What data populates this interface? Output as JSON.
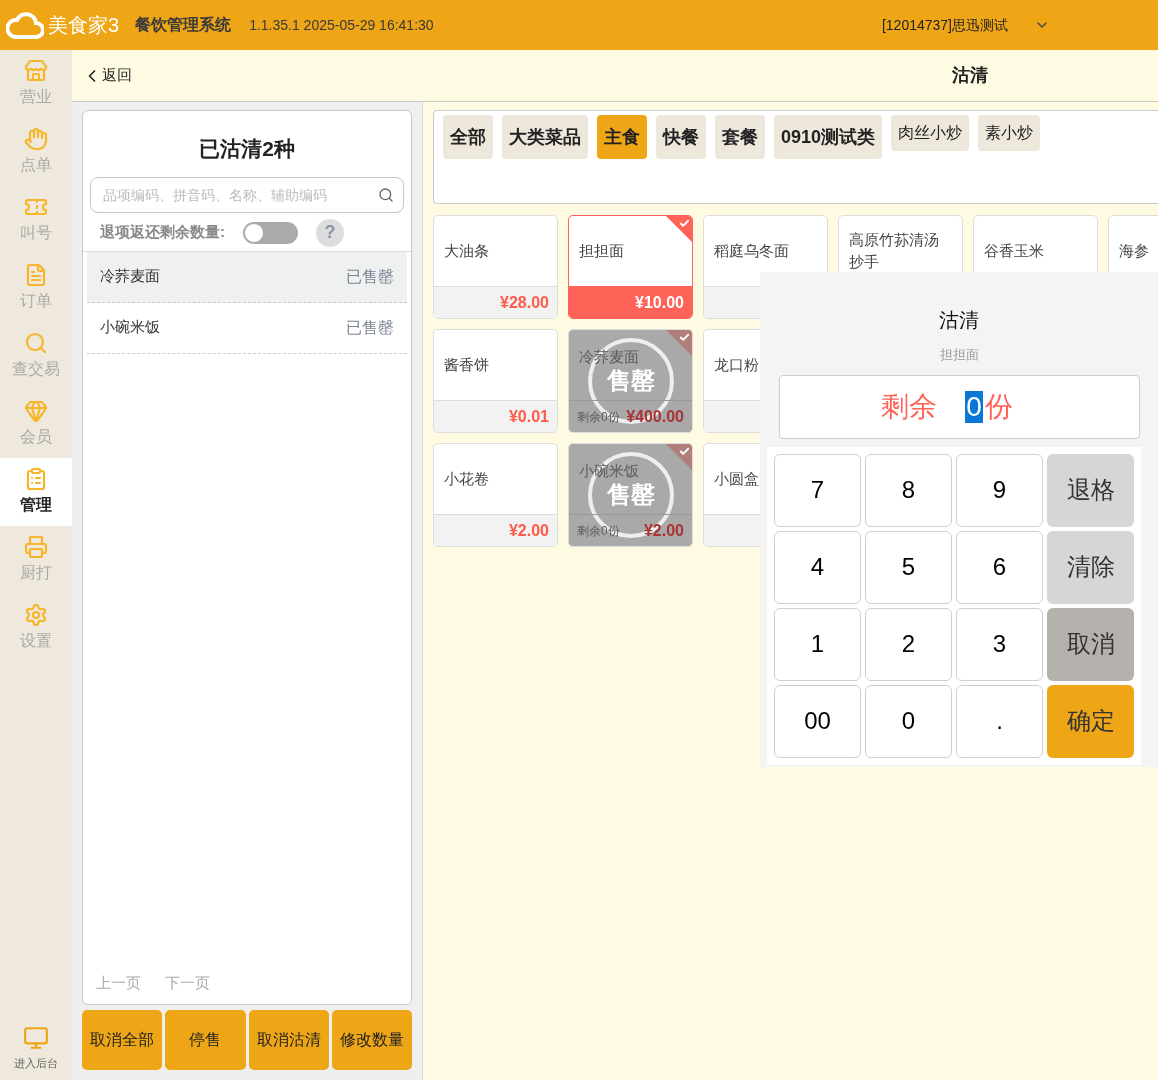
{
  "header": {
    "brand": "美食家3",
    "system": "餐饮管理系统",
    "version": "1.1.35.1 2025-05-29 16:41:30",
    "user": "[12014737]思迅测试"
  },
  "sidebar": {
    "items": [
      {
        "label": "营业",
        "selected": false
      },
      {
        "label": "点单",
        "selected": false
      },
      {
        "label": "叫号",
        "selected": false
      },
      {
        "label": "订单",
        "selected": false
      },
      {
        "label": "查交易",
        "selected": false
      },
      {
        "label": "会员",
        "selected": false
      },
      {
        "label": "管理",
        "selected": true
      },
      {
        "label": "厨打",
        "selected": false
      },
      {
        "label": "设置",
        "selected": false
      }
    ],
    "footer": "进入后台"
  },
  "subheader": {
    "back": "返回",
    "title": "沽清"
  },
  "left_panel": {
    "title": "已沽清2种",
    "search": {
      "placeholder": "品项编码、拼音码、名称、辅助编码"
    },
    "return_toggle": {
      "label": "退项返还剩余数量:",
      "on": false,
      "help": "?"
    },
    "items": [
      {
        "name": "冷荞麦面",
        "status": "已售罄",
        "selected": true
      },
      {
        "name": "小碗米饭",
        "status": "已售罄",
        "selected": false
      }
    ],
    "pager": [
      "上一页",
      "下一页"
    ],
    "buttons": [
      "取消全部",
      "停售",
      "取消沽清",
      "修改数量"
    ]
  },
  "categories": [
    {
      "label": "全部",
      "selected": false
    },
    {
      "label": "大类菜品",
      "selected": false
    },
    {
      "label": "主食",
      "selected": true
    },
    {
      "label": "快餐",
      "selected": false
    },
    {
      "label": "套餐",
      "selected": false
    },
    {
      "label": "0910测试类",
      "selected": false
    },
    {
      "label": "肉丝小炒",
      "selected": false
    },
    {
      "label": "素小炒",
      "selected": false
    }
  ],
  "dish_rows": [
    [
      {
        "name": "大油条",
        "price": "¥28.00",
        "selected": false,
        "sold_out": false
      },
      {
        "name": "担担面",
        "price": "¥10.00",
        "selected": true,
        "sold_out": false
      },
      {
        "name": "稻庭乌冬面",
        "selected": false,
        "sold_out": false
      },
      {
        "name": "高原竹荪清汤抄手",
        "selected": false,
        "sold_out": false
      },
      {
        "name": "谷香玉米",
        "selected": false,
        "sold_out": false
      },
      {
        "name": "海参",
        "selected": false,
        "sold_out": false
      }
    ],
    [
      {
        "name": "酱香饼",
        "price": "¥0.01",
        "selected": false,
        "sold_out": false
      },
      {
        "name": "冷荞麦面",
        "price": "¥400.00",
        "remaining": "剩余0份",
        "badge": "售罄",
        "selected": true,
        "sold_out": true
      },
      {
        "name": "龙口粉",
        "selected": false,
        "sold_out": false
      }
    ],
    [
      {
        "name": "小花卷",
        "price": "¥2.00",
        "selected": false,
        "sold_out": false
      },
      {
        "name": "小碗米饭",
        "price": "¥2.00",
        "remaining": "剩余0份",
        "badge": "售罄",
        "selected": true,
        "sold_out": true
      },
      {
        "name": "小圆盒",
        "selected": false,
        "sold_out": false
      }
    ]
  ],
  "dialog": {
    "title": "沽清",
    "dish": "担担面",
    "prefix": "剩余",
    "value": "0",
    "unit": "份",
    "keys": [
      {
        "label": "7",
        "kind": "digit"
      },
      {
        "label": "8",
        "kind": "digit"
      },
      {
        "label": "9",
        "kind": "digit"
      },
      {
        "label": "退格",
        "kind": "backspace"
      },
      {
        "label": "4",
        "kind": "digit"
      },
      {
        "label": "5",
        "kind": "digit"
      },
      {
        "label": "6",
        "kind": "digit"
      },
      {
        "label": "清除",
        "kind": "clear"
      },
      {
        "label": "1",
        "kind": "digit"
      },
      {
        "label": "2",
        "kind": "digit"
      },
      {
        "label": "3",
        "kind": "digit"
      },
      {
        "label": "取消",
        "kind": "cancel"
      },
      {
        "label": "00",
        "kind": "digit"
      },
      {
        "label": "0",
        "kind": "digit"
      },
      {
        "label": ".",
        "kind": "digit"
      },
      {
        "label": "确定",
        "kind": "confirm"
      }
    ]
  }
}
